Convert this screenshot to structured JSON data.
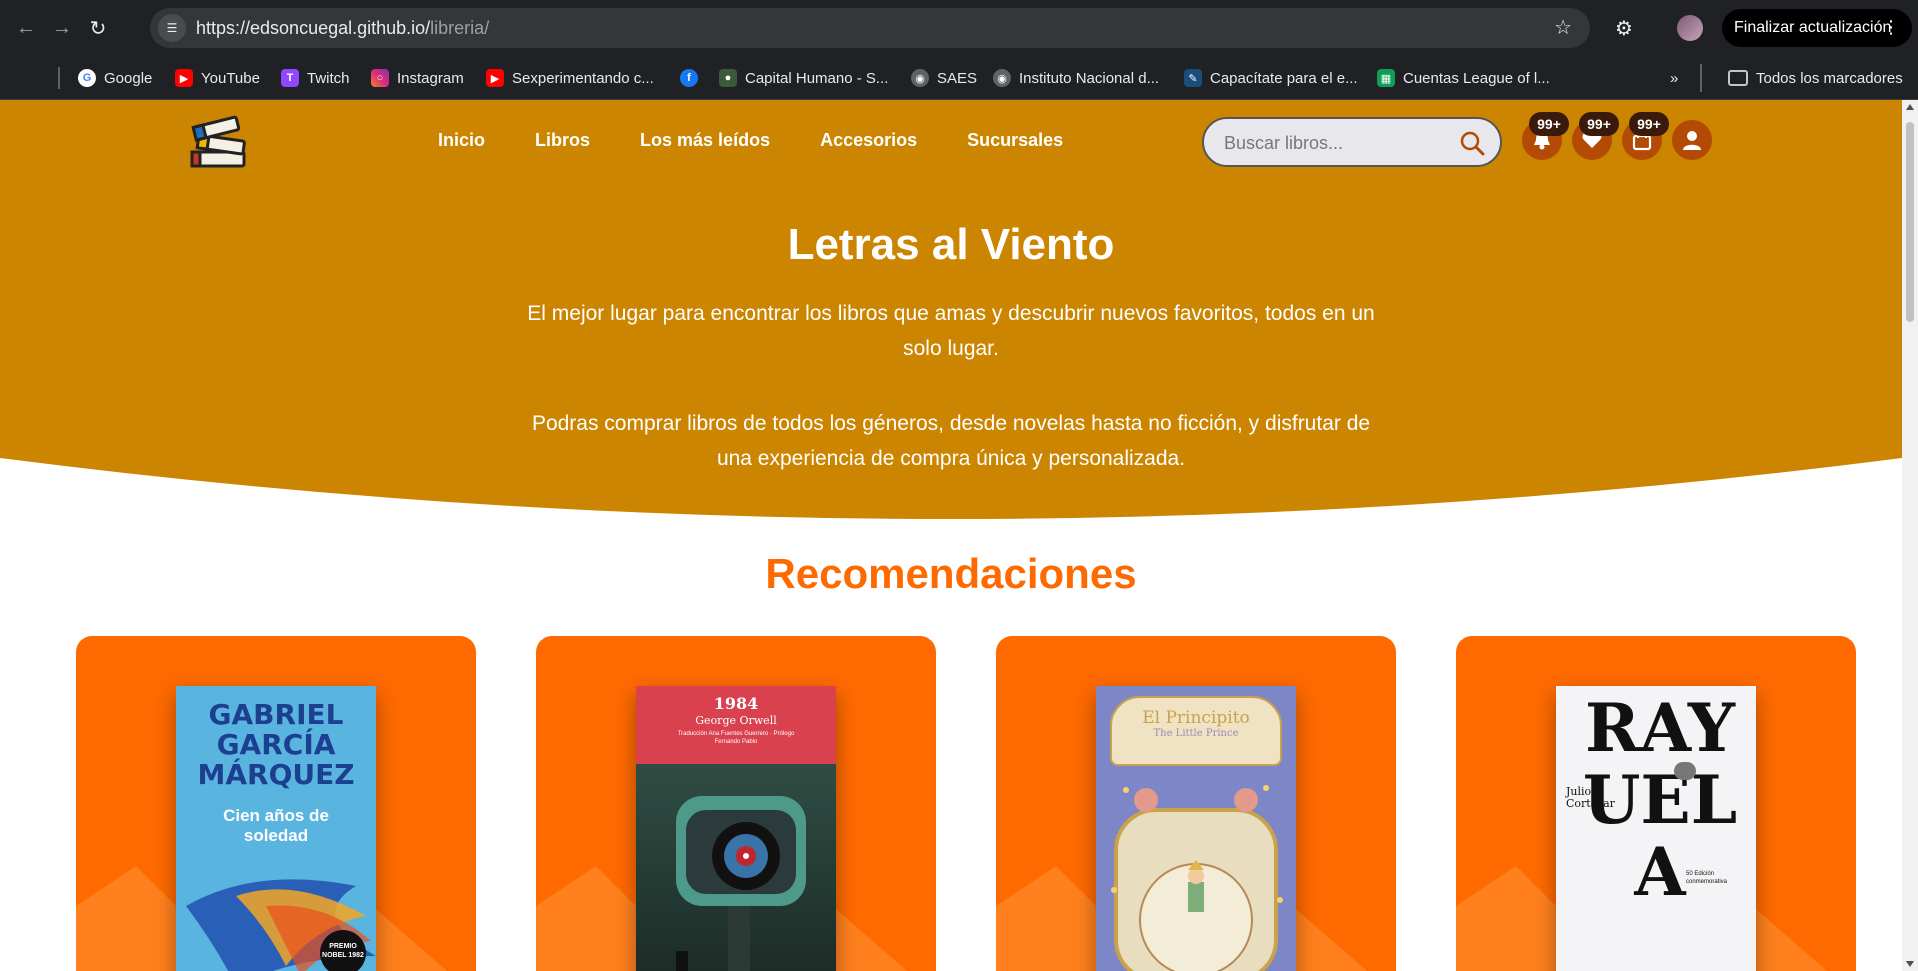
{
  "browser": {
    "url_host": "https://edsoncuegal.github.io/",
    "url_path": "libreria/",
    "update_button": "Finalizar actualización",
    "bookmarks": [
      {
        "label": "Google",
        "icon": "google-icon"
      },
      {
        "label": "YouTube",
        "icon": "youtube-icon"
      },
      {
        "label": "Twitch",
        "icon": "twitch-icon"
      },
      {
        "label": "Instagram",
        "icon": "instagram-icon"
      },
      {
        "label": "Sexperimentando c...",
        "icon": "youtube-icon"
      },
      {
        "label": "",
        "icon": "facebook-icon"
      },
      {
        "label": "Capital Humano - S...",
        "icon": "site-icon"
      },
      {
        "label": "SAES",
        "icon": "globe-icon"
      },
      {
        "label": "Instituto Nacional d...",
        "icon": "globe-icon"
      },
      {
        "label": "Capacítate para el e...",
        "icon": "site-icon"
      },
      {
        "label": "Cuentas League of l...",
        "icon": "sheets-icon"
      }
    ],
    "all_bookmarks": "Todos los marcadores"
  },
  "site": {
    "nav": [
      "Inicio",
      "Libros",
      "Los más leídos",
      "Accesorios",
      "Sucursales"
    ],
    "search_placeholder": "Buscar libros...",
    "badges": {
      "notifications": "99+",
      "favorites": "99+",
      "cart": "99+"
    },
    "hero_title": "Letras al Viento",
    "hero_paragraph_1": "El mejor lugar para encontrar los libros que amas y descubrir nuevos favoritos, todos en un solo lugar.",
    "hero_paragraph_2": "Podras comprar libros de todos los géneros, desde novelas hasta no ficción, y disfrutar de una experiencia de compra única y personalizada.",
    "section_title": "Recomendaciones",
    "books": [
      {
        "author": "GABRIEL GARCÍA MÁRQUEZ",
        "title": "Cien años de soledad",
        "badge": "PREMIO NOBEL 1982"
      },
      {
        "title": "1984",
        "author": "George Orwell",
        "credits": "Traducción Ana Fuentes Guerrero · Prólogo Fernando Pablo"
      },
      {
        "title": "El Principito",
        "subtitle": "The Little Prince"
      },
      {
        "author": "Julio Cortázar",
        "title": "RAYUELA",
        "note": "50 Edición conmemorativa"
      }
    ]
  },
  "colors": {
    "hero": "#cc8500",
    "accent": "#ff6a00",
    "icon_bg": "#b34a06"
  }
}
